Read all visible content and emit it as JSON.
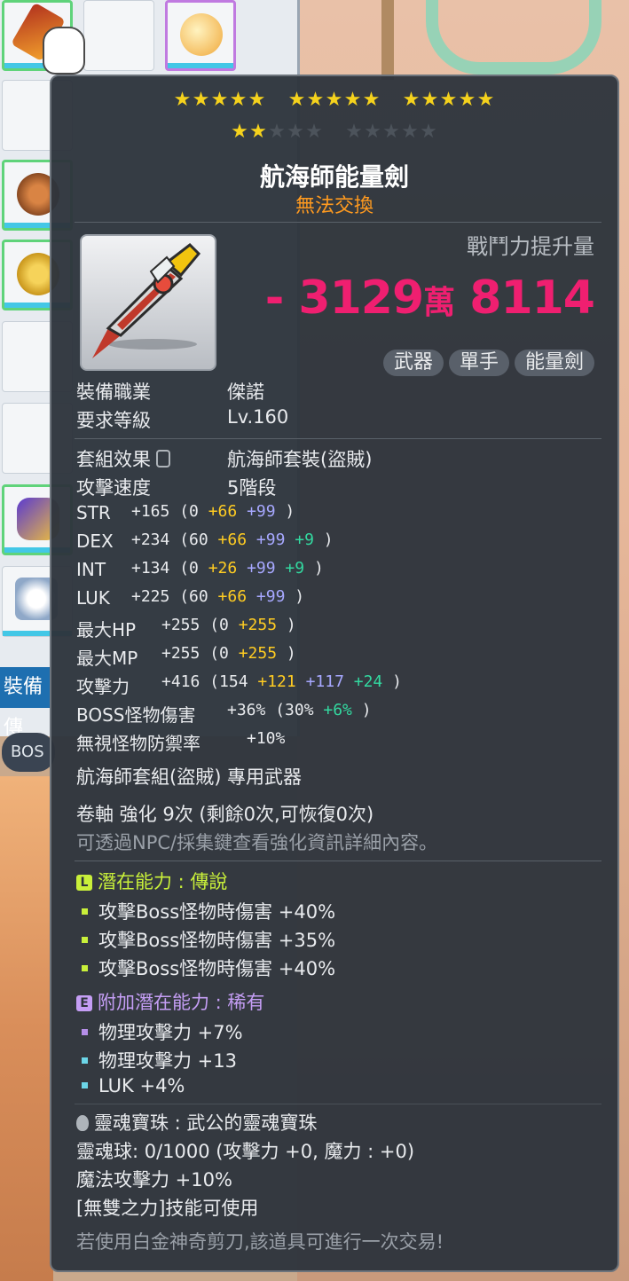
{
  "side": {
    "tab_label": "裝備傳",
    "boss_label": "BOS"
  },
  "item": {
    "stars_filled": 17,
    "stars_total": 25,
    "name": "航海師能量劍",
    "trade": "無法交換",
    "power_label": "戰鬥力提升量",
    "power_prefix": "- 3129",
    "power_unit": "萬",
    "power_suffix": " 8114",
    "tags": [
      "武器",
      "單手",
      "能量劍"
    ],
    "job_label": "裝備職業",
    "job_value": "傑諾",
    "req_level_label": "要求等級",
    "req_level_value": "Lv.160",
    "set_label": "套組效果",
    "set_value": "航海師套裝(盜賊)",
    "speed_label": "攻擊速度",
    "speed_value": "5階段"
  },
  "stats": [
    {
      "name": "STR",
      "total": "+165",
      "base": "(0",
      "parts": [
        {
          "t": "+66",
          "c": "y"
        },
        {
          "t": "+99",
          "c": "b"
        }
      ],
      "close": ")"
    },
    {
      "name": "DEX",
      "total": "+234",
      "base": "(60",
      "parts": [
        {
          "t": "+66",
          "c": "y"
        },
        {
          "t": "+99",
          "c": "b"
        },
        {
          "t": "+9",
          "c": "g"
        }
      ],
      "close": ")"
    },
    {
      "name": "INT",
      "total": "+134",
      "base": "(0",
      "parts": [
        {
          "t": "+26",
          "c": "y"
        },
        {
          "t": "+99",
          "c": "b"
        },
        {
          "t": "+9",
          "c": "g"
        }
      ],
      "close": ")"
    },
    {
      "name": "LUK",
      "total": "+225",
      "base": "(60",
      "parts": [
        {
          "t": "+66",
          "c": "y"
        },
        {
          "t": "+99",
          "c": "b"
        }
      ],
      "close": ")"
    },
    {
      "name": "最大HP",
      "total": "+255",
      "base": "(0",
      "parts": [
        {
          "t": "+255",
          "c": "y"
        }
      ],
      "close": ")"
    },
    {
      "name": "最大MP",
      "total": "+255",
      "base": "(0",
      "parts": [
        {
          "t": "+255",
          "c": "y"
        }
      ],
      "close": ")"
    },
    {
      "name": "攻擊力",
      "total": "+416",
      "base": "(154",
      "parts": [
        {
          "t": "+121",
          "c": "y"
        },
        {
          "t": "+117",
          "c": "b"
        },
        {
          "t": "+24",
          "c": "g"
        }
      ],
      "close": ")"
    },
    {
      "name": "BOSS怪物傷害",
      "total": "+36%",
      "base": "(30%",
      "parts": [
        {
          "t": "+6%",
          "c": "g"
        }
      ],
      "close": ")"
    },
    {
      "name": "無視怪物防禦率",
      "total": "+10%",
      "base": "",
      "parts": [],
      "close": ""
    }
  ],
  "set_weapon": "航海師套組(盜賊) 專用武器",
  "scroll": "卷軸 強化 9次 (剩餘0次,可恢復0次)",
  "scroll_hint": "可透過NPC/採集鍵查看強化資訊詳細內容。",
  "potential": {
    "header": "潛在能力 : 傳說",
    "badge": "L",
    "lines": [
      "攻擊Boss怪物時傷害 +40%",
      "攻擊Boss怪物時傷害 +35%",
      "攻擊Boss怪物時傷害 +40%"
    ]
  },
  "additional": {
    "header": "附加潛在能力 : 稀有",
    "badge": "E",
    "lines": [
      "物理攻擊力 +7%",
      "物理攻擊力 +13",
      "LUK +4%"
    ]
  },
  "soul": {
    "name": "靈魂寶珠 : 武公的靈魂寶珠",
    "count": "靈魂球: 0/1000 (攻擊力 +0, 魔力 : +0)",
    "effect": "魔法攻擊力 +10%",
    "skill": "[無雙之力]技能可使用"
  },
  "footer": "若使用白金神奇剪刀,該道具可進行一次交易!"
}
